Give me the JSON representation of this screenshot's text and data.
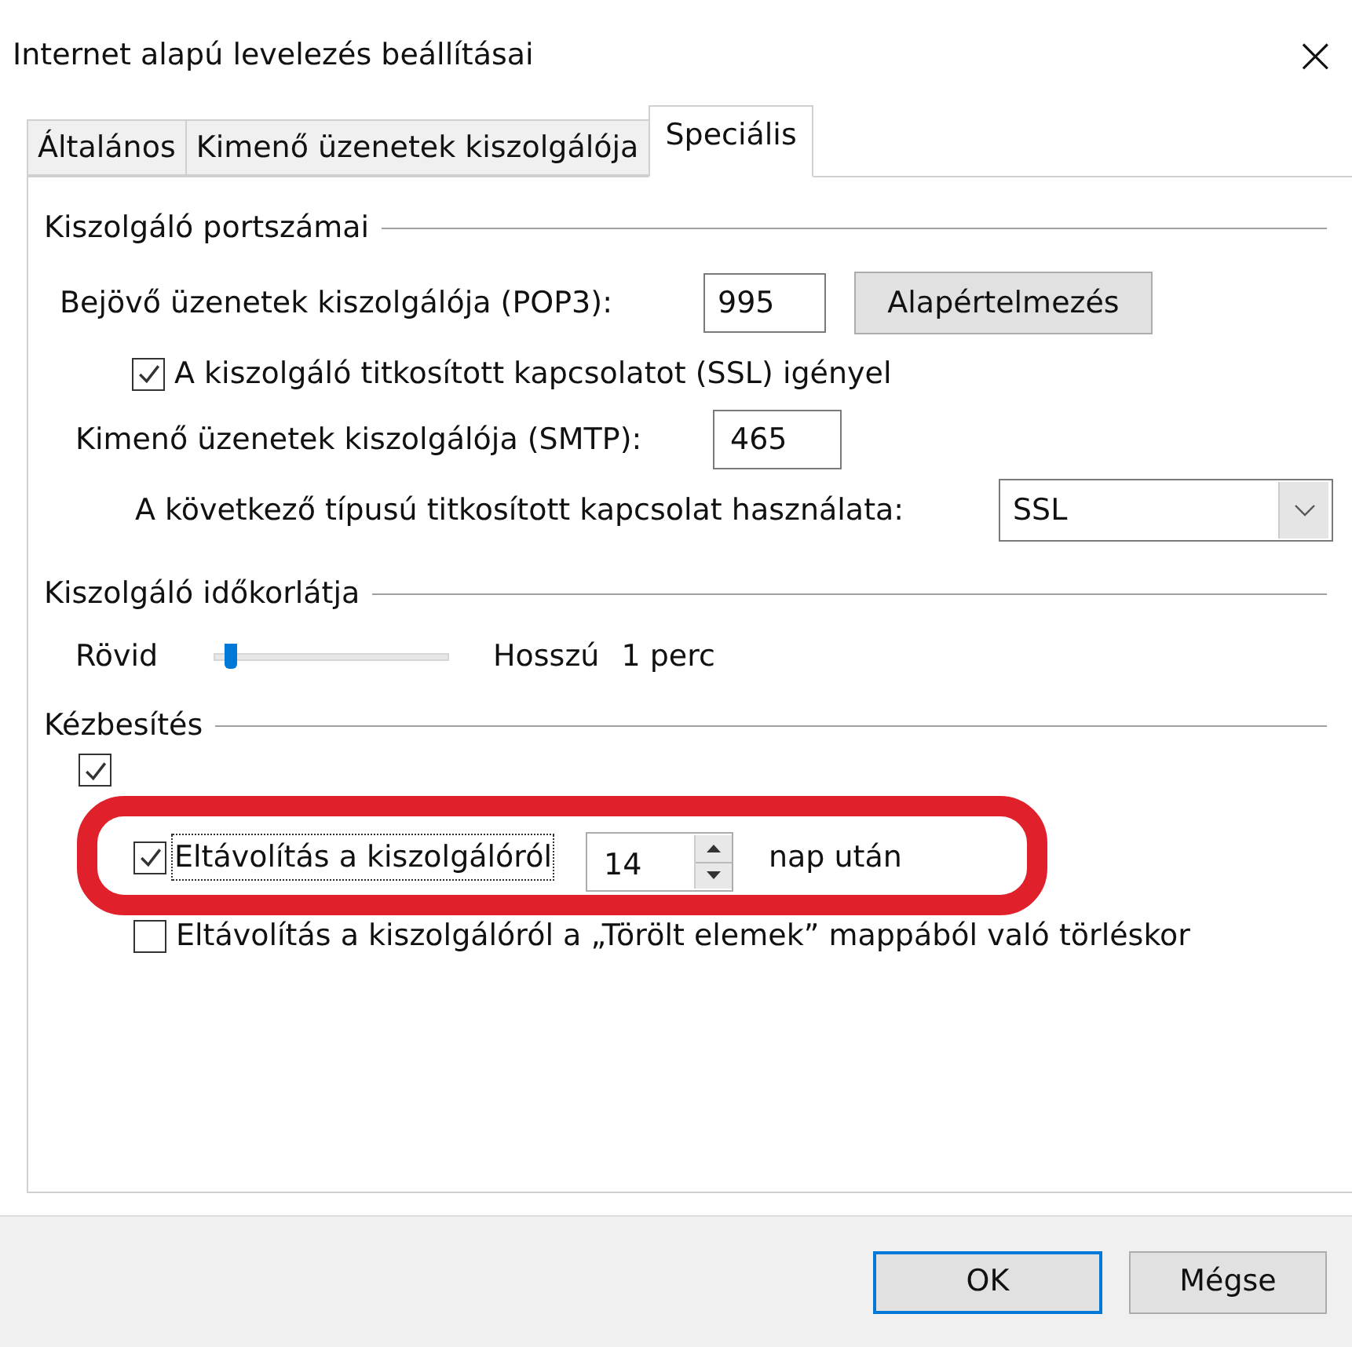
{
  "window": {
    "title": "Internet alapú levelezés beállításai",
    "close": "×"
  },
  "tabs": [
    {
      "label": "Általános",
      "selected": false
    },
    {
      "label": "Kimenő üzenetek kiszolgálója",
      "selected": false
    },
    {
      "label": "Speciális",
      "selected": true
    }
  ],
  "ports": {
    "heading": "Kiszolgáló portszámai",
    "pop3_label": "Bejövő üzenetek kiszolgálója (POP3):",
    "pop3_value": "995",
    "default_button": "Alapértelmezés",
    "ssl_required": {
      "label": "A kiszolgáló titkosított kapcsolatot (SSL) igényel",
      "checked": true
    },
    "smtp_label": "Kimenő üzenetek kiszolgálója (SMTP):",
    "smtp_value": "465",
    "encryption_label": "A következő típusú titkosított kapcsolat használata:",
    "encryption_value": "SSL"
  },
  "timeout": {
    "heading": "Kiszolgáló időkorlátja",
    "min_label": "Rövid",
    "max_label": "Hosszú",
    "level": 0.07,
    "reading": "1 perc"
  },
  "delivery": {
    "heading": "Kézbesítés",
    "hidden_option": {
      "checked": true
    },
    "remove": {
      "label": "Eltávolítás a kiszolgálóról",
      "checked": true,
      "days": "14",
      "suffix": "nap után"
    },
    "remove_on_delete": {
      "label": "Eltávolítás a kiszolgálóról a „Törölt elemek” mappából való törléskor",
      "checked": false
    }
  },
  "annotation": {
    "shown": true
  },
  "buttons": [
    {
      "label": "OK",
      "default": true
    },
    {
      "label": "Mégse",
      "default": false
    }
  ]
}
